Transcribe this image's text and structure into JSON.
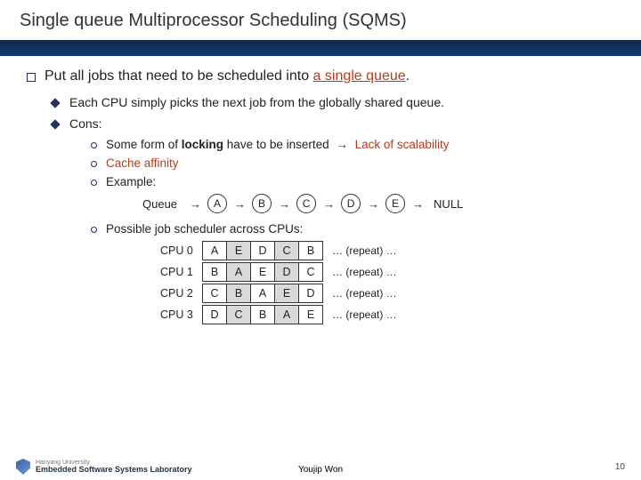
{
  "title": "Single queue Multiprocessor Scheduling (SQMS)",
  "main": {
    "intro_prefix": "Put all jobs that need to be scheduled into ",
    "intro_accent": "a single queue",
    "intro_suffix": ".",
    "bullet_shared": "Each CPU simply picks the next job from the globally shared queue.",
    "cons_label": "Cons:",
    "cons": {
      "locking_prefix": "Some form of ",
      "locking_bold": "locking",
      "locking_mid": " have to be inserted ",
      "locking_arrow": "→",
      "locking_accent": " Lack of scalability",
      "affinity": "Cache affinity",
      "example_label": "Example:",
      "possible_label": "Possible job scheduler across CPUs:"
    }
  },
  "queue": {
    "label": "Queue",
    "items": [
      "A",
      "B",
      "C",
      "D",
      "E"
    ],
    "arrow": "→",
    "null": "NULL"
  },
  "schedule": {
    "rows": [
      {
        "label": "CPU 0",
        "cells": [
          "A",
          "E",
          "D",
          "C",
          "B"
        ]
      },
      {
        "label": "CPU 1",
        "cells": [
          "B",
          "A",
          "E",
          "D",
          "C"
        ]
      },
      {
        "label": "CPU 2",
        "cells": [
          "C",
          "B",
          "A",
          "E",
          "D"
        ]
      },
      {
        "label": "CPU 3",
        "cells": [
          "D",
          "C",
          "B",
          "A",
          "E"
        ]
      }
    ],
    "tail": "… (repeat) …"
  },
  "footer": {
    "university": "Hanyang University",
    "lab": "Embedded Software Systems Laboratory",
    "author": "Youjip Won",
    "page": "10"
  },
  "chart_data": {
    "type": "table",
    "title": "Possible job scheduler across CPUs",
    "queue": [
      "A",
      "B",
      "C",
      "D",
      "E"
    ],
    "cpus": {
      "CPU 0": [
        "A",
        "E",
        "D",
        "C",
        "B"
      ],
      "CPU 1": [
        "B",
        "A",
        "E",
        "D",
        "C"
      ],
      "CPU 2": [
        "C",
        "B",
        "A",
        "E",
        "D"
      ],
      "CPU 3": [
        "D",
        "C",
        "B",
        "A",
        "E"
      ]
    },
    "note": "pattern repeats"
  }
}
